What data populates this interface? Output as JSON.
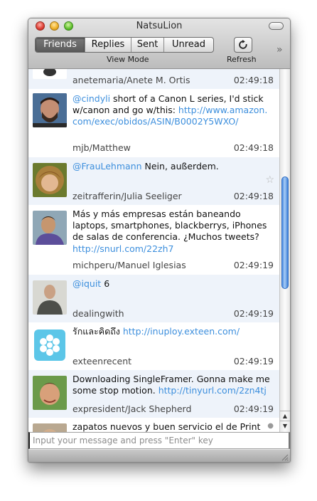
{
  "window": {
    "title": "NatsuLion"
  },
  "toolbar": {
    "view_modes": [
      {
        "label": "Friends",
        "active": true
      },
      {
        "label": "Replies",
        "active": false
      },
      {
        "label": "Sent",
        "active": false
      },
      {
        "label": "Unread",
        "active": false
      }
    ],
    "view_mode_caption": "View Mode",
    "refresh_icon": "refresh-icon",
    "refresh_caption": "Refresh",
    "overflow_icon": "double-chevron-right-icon"
  },
  "timeline": {
    "statuses": [
      {
        "text_parts": [],
        "author": "anetemaria/Anete M. Ortis",
        "time": "02:49:18"
      },
      {
        "text_parts": [
          {
            "type": "mention",
            "text": "@cindyli"
          },
          {
            "type": "text",
            "text": " short of a Canon L series, I'd stick w/canon and go w/this: "
          },
          {
            "type": "url",
            "text": "http://www.amazon.com/exec/obidos/ASIN/B0002Y5WXO/"
          }
        ],
        "author": "mjb/Matthew",
        "time": "02:49:18"
      },
      {
        "text_parts": [
          {
            "type": "mention",
            "text": "@FrauLehmann"
          },
          {
            "type": "text",
            "text": " Nein, außerdem."
          }
        ],
        "author": "zeitrafferin/Julia Seeliger",
        "time": "02:49:18"
      },
      {
        "text_parts": [
          {
            "type": "text",
            "text": "Más y más empresas están baneando laptops, smartphones, blackberrys, iPhones de salas de conferencia. ¿Muchos tweets? "
          },
          {
            "type": "url",
            "text": "http://snurl.com/22zh7"
          }
        ],
        "author": "michperu/Manuel Iglesias",
        "time": "02:49:19"
      },
      {
        "text_parts": [
          {
            "type": "mention",
            "text": "@iquit"
          },
          {
            "type": "text",
            "text": " 6"
          }
        ],
        "author": "dealingwith",
        "time": "02:49:19"
      },
      {
        "text_parts": [
          {
            "type": "text",
            "text": "รักและคิดถึง "
          },
          {
            "type": "url",
            "text": "http://inuploy.exteen.com/"
          }
        ],
        "author": "exteenrecent",
        "time": "02:49:19"
      },
      {
        "text_parts": [
          {
            "type": "text",
            "text": "Downloading SingleFramer. Gonna make me some stop motion. "
          },
          {
            "type": "url",
            "text": "http://tinyurl.com/2zn4tj"
          }
        ],
        "author": "expresident/Jack Shepherd",
        "time": "02:49:19"
      },
      {
        "text_parts": [
          {
            "type": "text",
            "text": "zapatos nuevos y  buen servicio el de Print"
          }
        ],
        "author": "",
        "time": ""
      }
    ]
  },
  "composer": {
    "placeholder": "Input your message and press \"Enter\" key",
    "value": ""
  },
  "colors": {
    "link": "#3d8fdd",
    "alt_row": "#eef3fa",
    "scroll_thumb": "#4c8be2"
  }
}
